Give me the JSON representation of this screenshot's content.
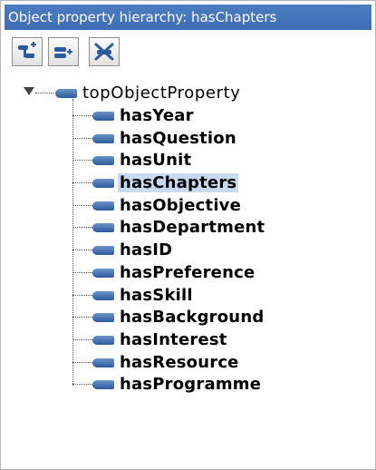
{
  "window": {
    "title": "Object property hierarchy: hasChapters"
  },
  "toolbar": {
    "buttons": [
      {
        "icon": "add-subproperty-icon"
      },
      {
        "icon": "add-sibling-property-icon"
      },
      {
        "icon": "delete-property-icon"
      }
    ]
  },
  "tree": {
    "root": {
      "label": "topObjectProperty",
      "expanded": true
    },
    "children": [
      {
        "label": "hasYear"
      },
      {
        "label": "hasQuestion"
      },
      {
        "label": "hasUnit"
      },
      {
        "label": "hasChapters",
        "selected": true
      },
      {
        "label": "hasObjective"
      },
      {
        "label": "hasDepartment"
      },
      {
        "label": "hasID"
      },
      {
        "label": "hasPreference"
      },
      {
        "label": "hasSkill"
      },
      {
        "label": "hasBackground"
      },
      {
        "label": "hasInterest"
      },
      {
        "label": "hasResource"
      },
      {
        "label": "hasProgramme"
      }
    ]
  },
  "colors": {
    "title_bar": "#3d6db5",
    "selection": "#c8daf2",
    "property_bullet": "#2c5a9c"
  }
}
